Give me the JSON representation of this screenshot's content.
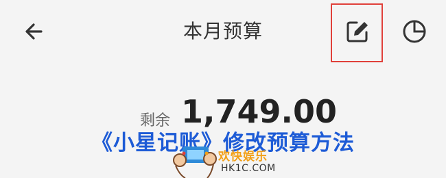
{
  "header": {
    "title": "本月预算",
    "back_icon": "arrow-left-icon",
    "edit_icon": "edit-icon",
    "chart_icon": "pie-chart-icon"
  },
  "balance": {
    "label": "剩余",
    "amount": "1,749.00"
  },
  "overlay": {
    "caption": "《小星记账》修改预算方法"
  },
  "watermark": {
    "brand": "欢快娱乐",
    "domain": "HK1C.COM"
  },
  "colors": {
    "highlight": "#e0403a",
    "caption": "#1d5bd6",
    "brand": "#f2a019"
  }
}
